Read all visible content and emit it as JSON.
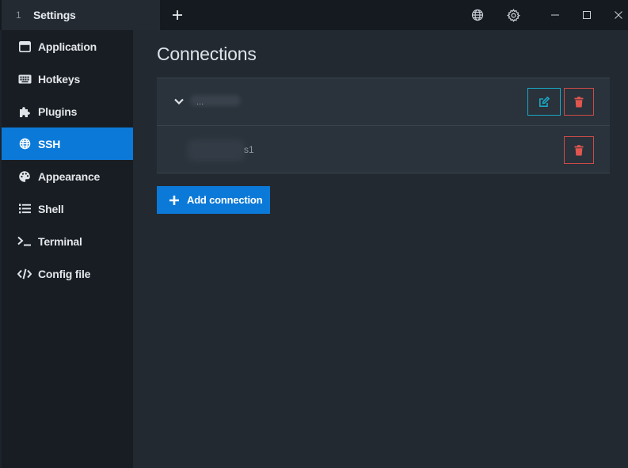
{
  "tab": {
    "index": "1",
    "title": "Settings"
  },
  "titlebar": {
    "new_tab_label": "+"
  },
  "sidebar": {
    "items": [
      {
        "label": "Application",
        "icon": "window-icon"
      },
      {
        "label": "Hotkeys",
        "icon": "keyboard-icon"
      },
      {
        "label": "Plugins",
        "icon": "puzzle-icon"
      },
      {
        "label": "SSH",
        "icon": "globe-icon",
        "active": true
      },
      {
        "label": "Appearance",
        "icon": "palette-icon"
      },
      {
        "label": "Shell",
        "icon": "list-icon"
      },
      {
        "label": "Terminal",
        "icon": "terminal-icon"
      },
      {
        "label": "Config file",
        "icon": "code-icon"
      }
    ]
  },
  "main": {
    "title": "Connections",
    "connections": [
      {
        "name": "...",
        "group": true
      },
      {
        "name": "s1"
      }
    ],
    "add_label": "Add connection"
  },
  "colors": {
    "accent": "#0b79d8",
    "edit_border": "#1aa8c4",
    "delete": "#cc4b48",
    "sidebar_bg": "#181d23",
    "main_bg": "#222931"
  }
}
